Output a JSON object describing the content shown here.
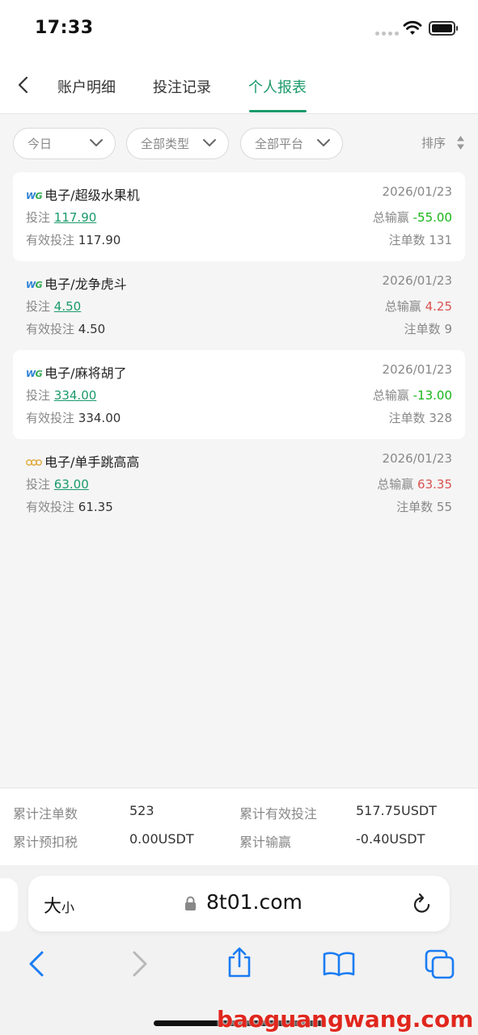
{
  "status_bar": {
    "time": "17:33"
  },
  "nav": {
    "tabs": [
      {
        "label": "账户明细",
        "active": false
      },
      {
        "label": "投注记录",
        "active": false
      },
      {
        "label": "个人报表",
        "active": true
      }
    ],
    "accent_color": "#1b9a6b"
  },
  "filters": {
    "date": "今日",
    "type": "全部类型",
    "platform": "全部平台",
    "sort_label": "排序"
  },
  "records": [
    {
      "provider_logo": "WG",
      "name": "电子/超级水果机",
      "date": "2026/01/23",
      "bet_label": "投注",
      "bet": "117.90",
      "winloss_label": "总输赢",
      "winloss": "-55.00",
      "valid_label": "有效投注",
      "valid": "117.90",
      "count_label": "注单数",
      "count": "131"
    },
    {
      "provider_logo": "WG",
      "name": "电子/龙争虎斗",
      "date": "2026/01/23",
      "bet_label": "投注",
      "bet": "4.50",
      "winloss_label": "总输赢",
      "winloss": "4.25",
      "valid_label": "有效投注",
      "valid": "4.50",
      "count_label": "注单数",
      "count": "9"
    },
    {
      "provider_logo": "WG",
      "name": "电子/麻将胡了",
      "date": "2026/01/23",
      "bet_label": "投注",
      "bet": "334.00",
      "winloss_label": "总输赢",
      "winloss": "-13.00",
      "valid_label": "有效投注",
      "valid": "334.00",
      "count_label": "注单数",
      "count": "328"
    },
    {
      "provider_logo": "ring",
      "name": "电子/单手跳高高",
      "date": "2026/01/23",
      "bet_label": "投注",
      "bet": "63.00",
      "winloss_label": "总输赢",
      "winloss": "63.35",
      "valid_label": "有效投注",
      "valid": "61.35",
      "count_label": "注单数",
      "count": "55"
    }
  ],
  "summary": {
    "total_count_label": "累计注单数",
    "total_count": "523",
    "total_valid_label": "累计有效投注",
    "total_valid": "517.75USDT",
    "tax_label": "累计预扣税",
    "tax": "0.00USDT",
    "total_winloss_label": "累计输赢",
    "total_winloss": "-0.40USDT"
  },
  "browser": {
    "text_size_label_big": "大",
    "text_size_label_small": "小",
    "url": "8t01.com"
  },
  "watermark": "baoguangwang.com",
  "colors": {
    "positive": "#d9534f",
    "negative": "#18b418",
    "link": "#1b9a6b"
  }
}
